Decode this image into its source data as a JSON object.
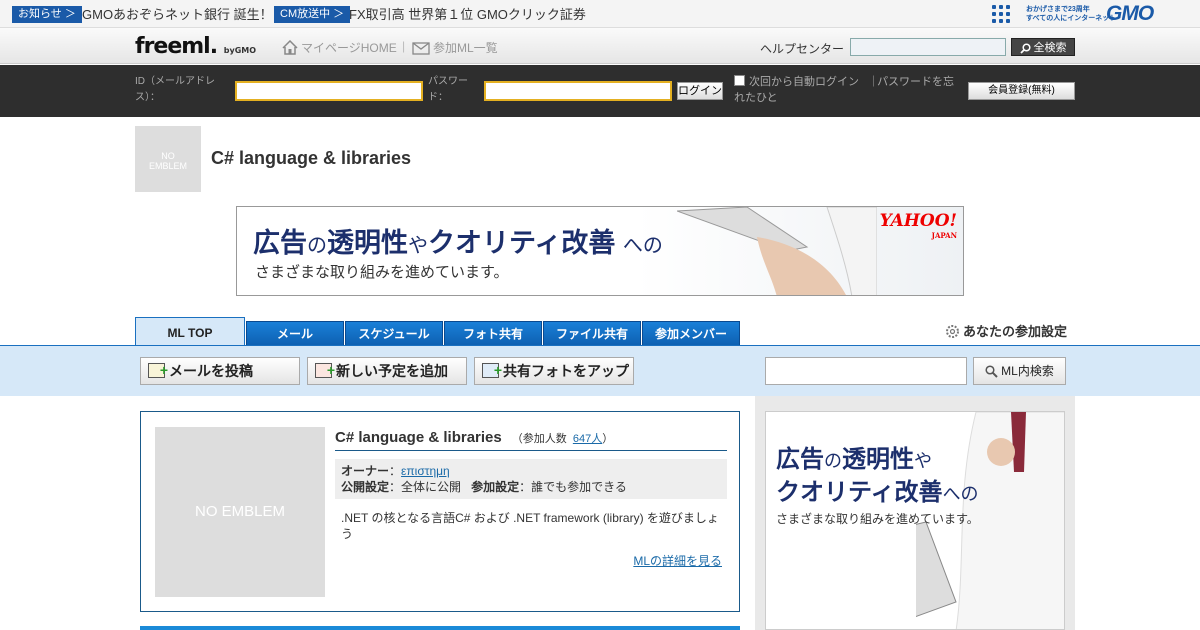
{
  "newsbar": {
    "tag1": "お知らせ ＞",
    "text1": "GMOあおぞらネット銀行 誕生！",
    "tag2": "CM放送中 ＞",
    "text2": "FX取引高 世界第１位 GMOクリック証券",
    "slogan_line1": "おかげさまで23周年",
    "slogan_line2": "すべての人にインターネット",
    "gmo_logo": "GMO"
  },
  "header": {
    "logo": "freeml.",
    "logo_by": "byGMO",
    "home_link": "マイページHOME",
    "separator": "|",
    "mlist_link": "参加ML一覧",
    "help": "ヘルプセンター",
    "search_button": "全検索"
  },
  "login": {
    "id_label_line1": "ID（メールアドレ",
    "id_label_line2": "ス）：",
    "pw_label_line1": "パスワー",
    "pw_label_line2": "ド：",
    "login_button": "ログイン",
    "autologin": "次回から自動ログイン",
    "divider": "｜",
    "forgot": "パスワードを忘れたひと",
    "register_button": "会員登録(無料)"
  },
  "group": {
    "emblem_line1": "NO",
    "emblem_line2": "EMBLEM",
    "title": "C# language & libraries"
  },
  "banner": {
    "heading_a": "広告",
    "heading_b": "の",
    "heading_c": "透明性",
    "heading_d": "や",
    "heading_e": "クオリティ改善",
    "heading_f": "への",
    "subline": "さまざまな取り組みを進めています。",
    "yahoo": "YAHOO!",
    "yahoo_sub": "JAPAN"
  },
  "tabs": [
    {
      "label": "ML TOP"
    },
    {
      "label": "メール"
    },
    {
      "label": "スケジュール"
    },
    {
      "label": "フォト共有"
    },
    {
      "label": "ファイル共有"
    },
    {
      "label": "参加メンバー"
    }
  ],
  "settings_link": "あなたの参加設定",
  "toolbar": {
    "post_mail": "メールを投稿",
    "add_schedule": "新しい予定を追加",
    "upload_photo": "共有フォトをアップ",
    "search_button": "ML内検索"
  },
  "card": {
    "emblem": "NO EMBLEM",
    "title": "C# language & libraries",
    "members_prefix": "（参加人数",
    "members_count": "647人",
    "members_suffix": "）",
    "owner_label": "オーナー",
    "owner_name": "επιστημη",
    "visibility_label": "公開設定",
    "visibility_value": "全体に公開",
    "join_label": "参加設定",
    "join_value": "誰でも参加できる",
    "description": ".NET の核となる言語C# および .NET framework (library) を遊びましょう",
    "detail_link": "MLの詳細を見る"
  },
  "sidead": {
    "line1_a": "広告",
    "line1_b": "の",
    "line1_c": "透明性",
    "line1_d": "や",
    "line2_a": "クオリティ改善",
    "line2_b": "への",
    "subline": "さまざまな取り組みを進めています。"
  },
  "colors": {
    "brand_blue": "#1a5aa8",
    "tab_blue": "#1a80d8",
    "toolbar_bg": "#d6e8f8",
    "login_bar": "#2e2e2e",
    "input_border": "#e4b021"
  }
}
